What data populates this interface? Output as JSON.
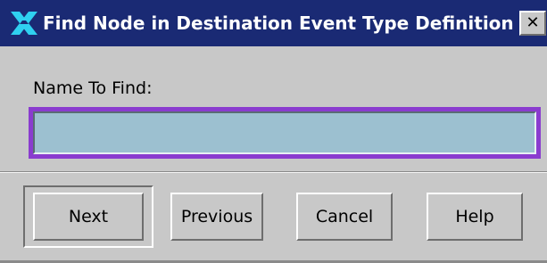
{
  "window": {
    "title": "Find Node in Destination Event Type Definition",
    "close_glyph": "✕",
    "icon": "x-logo-icon",
    "colors": {
      "titlebar": "#1a2a74",
      "body": "#c8c8c8",
      "input_background": "#9cc0d0",
      "focus_ring": "#8a3ccf"
    }
  },
  "form": {
    "name_label": "Name To Find:",
    "name_value": ""
  },
  "buttons": {
    "next": "Next",
    "previous": "Previous",
    "cancel": "Cancel",
    "help": "Help"
  }
}
